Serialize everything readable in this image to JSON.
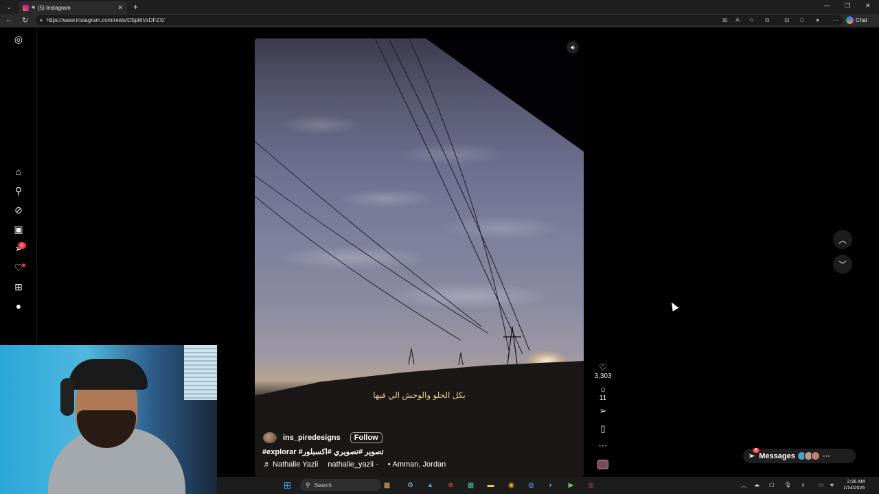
{
  "browser": {
    "tab_title": "(5) Instagram",
    "url": "https://www.instagram.com/reels/DSpt6VxDFZX/",
    "chat_label": "Chat"
  },
  "sidebar": {
    "notifications_badge": "6",
    "items": [
      "instagram-logo",
      "home",
      "search",
      "explore",
      "reels",
      "messages",
      "notifications",
      "create",
      "profile"
    ]
  },
  "reel": {
    "arabic_caption": "بكل الحلو والوحش الي فيها",
    "username": "ins_piredesigns",
    "follow_label": "Follow",
    "hashtags": "#explorar #تصوير #تصويري #اكسبلور",
    "audio_artist": "♬ Nathalie Yazii",
    "audio_handle": "nathalie_yazii ·",
    "location": "Amman, Jordan",
    "likes": "3,303",
    "comments": "11"
  },
  "messages_pill": {
    "label": "Messages",
    "badge": "6"
  },
  "taskbar": {
    "search_placeholder": "Search",
    "time": "2:36 AM",
    "date": "1/14/2026"
  }
}
